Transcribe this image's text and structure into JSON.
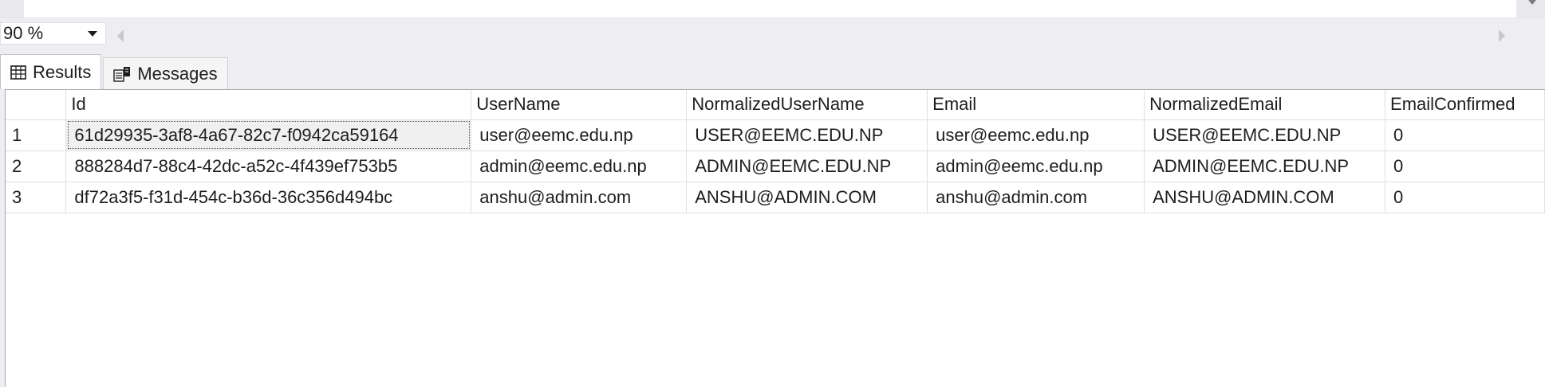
{
  "zoom": {
    "value": "90 %"
  },
  "tabs": [
    {
      "label": "Results",
      "icon": "grid-icon"
    },
    {
      "label": "Messages",
      "icon": "messages-icon"
    }
  ],
  "results": {
    "columns": [
      "Id",
      "UserName",
      "NormalizedUserName",
      "Email",
      "NormalizedEmail",
      "EmailConfirmed"
    ],
    "rows": [
      {
        "n": "1",
        "cells": [
          "61d29935-3af8-4a67-82c7-f0942ca59164",
          "user@eemc.edu.np",
          "USER@EEMC.EDU.NP",
          "user@eemc.edu.np",
          "USER@EEMC.EDU.NP",
          "0"
        ]
      },
      {
        "n": "2",
        "cells": [
          "888284d7-88c4-42dc-a52c-4f439ef753b5",
          "admin@eemc.edu.np",
          "ADMIN@EEMC.EDU.NP",
          "admin@eemc.edu.np",
          "ADMIN@EEMC.EDU.NP",
          "0"
        ]
      },
      {
        "n": "3",
        "cells": [
          "df72a3f5-f31d-454c-b36d-36c356d494bc",
          "anshu@admin.com",
          "ANSHU@ADMIN.COM",
          "anshu@admin.com",
          "ANSHU@ADMIN.COM",
          "0"
        ]
      }
    ]
  }
}
